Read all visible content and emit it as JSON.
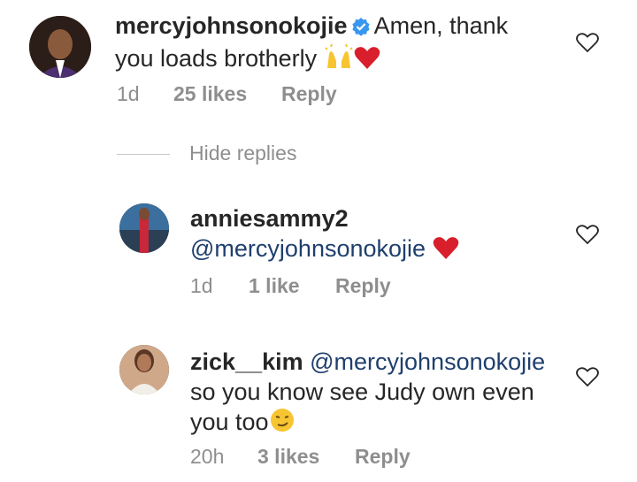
{
  "comments": [
    {
      "username": "mercyjohnsonokojie",
      "verified": true,
      "text_line1": "Amen, thank",
      "text_line2": "you loads brotherly",
      "time": "1d",
      "likes": "25 likes",
      "reply": "Reply"
    }
  ],
  "hide_replies": "Hide replies",
  "replies": [
    {
      "username": "anniesammy2",
      "mention": "@mercyjohnsonokojie",
      "time": "1d",
      "likes": "1 like",
      "reply": "Reply"
    },
    {
      "username": "zick__kim",
      "mention": "@mercyjohnsonokojie",
      "text_line2": "so you know see Judy own even",
      "text_line3": "you too",
      "time": "20h",
      "likes": "3 likes",
      "reply": "Reply"
    }
  ],
  "icons": {
    "like": "heart-outline-icon",
    "verified": "verified-badge-icon",
    "emoji_hands": "raising-hands-emoji",
    "emoji_heart": "red-heart-emoji",
    "emoji_smirk": "smirking-face-emoji"
  },
  "colors": {
    "text": "#262626",
    "meta": "#8e8e8e",
    "mention": "#1f3f6d",
    "verified": "#3897f0",
    "heart": "#ed4956"
  }
}
